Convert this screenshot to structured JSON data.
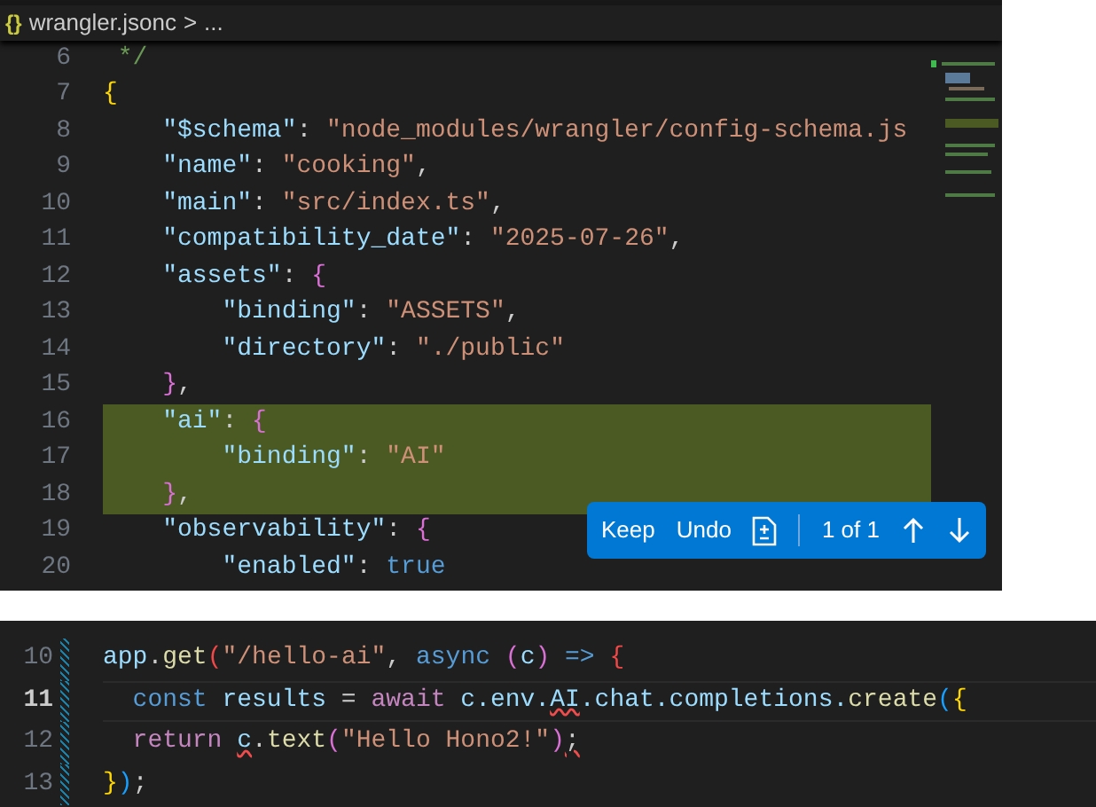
{
  "editor": {
    "breadcrumb": {
      "icon": "{}",
      "file": "wrangler.jsonc",
      "separator": ">",
      "more": "..."
    },
    "lines": [
      {
        "number": "6",
        "highlighted": false,
        "tokens": [
          {
            "kind": "comment",
            "text": " */"
          }
        ]
      },
      {
        "number": "7",
        "highlighted": false,
        "tokens": [
          {
            "kind": "brace1",
            "text": "{"
          }
        ]
      },
      {
        "number": "8",
        "highlighted": false,
        "tokens": [
          {
            "kind": "key",
            "text": "    \"$schema\""
          },
          {
            "kind": "punct",
            "text": ": "
          },
          {
            "kind": "string",
            "text": "\"node_modules/wrangler/config-schema.js"
          }
        ]
      },
      {
        "number": "9",
        "highlighted": false,
        "tokens": [
          {
            "kind": "key",
            "text": "    \"name\""
          },
          {
            "kind": "punct",
            "text": ": "
          },
          {
            "kind": "string",
            "text": "\"cooking\""
          },
          {
            "kind": "punct",
            "text": ","
          }
        ]
      },
      {
        "number": "10",
        "highlighted": false,
        "tokens": [
          {
            "kind": "key",
            "text": "    \"main\""
          },
          {
            "kind": "punct",
            "text": ": "
          },
          {
            "kind": "string",
            "text": "\"src/index.ts\""
          },
          {
            "kind": "punct",
            "text": ","
          }
        ]
      },
      {
        "number": "11",
        "highlighted": false,
        "tokens": [
          {
            "kind": "key",
            "text": "    \"compatibility_date\""
          },
          {
            "kind": "punct",
            "text": ": "
          },
          {
            "kind": "string",
            "text": "\"2025-07-26\""
          },
          {
            "kind": "punct",
            "text": ","
          }
        ]
      },
      {
        "number": "12",
        "highlighted": false,
        "tokens": [
          {
            "kind": "key",
            "text": "    \"assets\""
          },
          {
            "kind": "punct",
            "text": ": "
          },
          {
            "kind": "brace2",
            "text": "{"
          }
        ]
      },
      {
        "number": "13",
        "highlighted": false,
        "tokens": [
          {
            "kind": "key",
            "text": "        \"binding\""
          },
          {
            "kind": "punct",
            "text": ": "
          },
          {
            "kind": "string",
            "text": "\"ASSETS\""
          },
          {
            "kind": "punct",
            "text": ","
          }
        ]
      },
      {
        "number": "14",
        "highlighted": false,
        "tokens": [
          {
            "kind": "key",
            "text": "        \"directory\""
          },
          {
            "kind": "punct",
            "text": ": "
          },
          {
            "kind": "string",
            "text": "\"./public\""
          }
        ]
      },
      {
        "number": "15",
        "highlighted": false,
        "tokens": [
          {
            "kind": "brace2",
            "text": "    }"
          },
          {
            "kind": "punct",
            "text": ","
          }
        ]
      },
      {
        "number": "16",
        "highlighted": true,
        "tokens": [
          {
            "kind": "key",
            "text": "    \"ai\""
          },
          {
            "kind": "punct",
            "text": ": "
          },
          {
            "kind": "brace2",
            "text": "{"
          }
        ]
      },
      {
        "number": "17",
        "highlighted": true,
        "tokens": [
          {
            "kind": "key",
            "text": "        \"binding\""
          },
          {
            "kind": "punct",
            "text": ": "
          },
          {
            "kind": "string",
            "text": "\"AI\""
          }
        ]
      },
      {
        "number": "18",
        "highlighted": true,
        "tokens": [
          {
            "kind": "brace2",
            "text": "    }"
          },
          {
            "kind": "punct",
            "text": ","
          }
        ]
      },
      {
        "number": "19",
        "highlighted": false,
        "tokens": [
          {
            "kind": "key",
            "text": "    \"observability\""
          },
          {
            "kind": "punct",
            "text": ": "
          },
          {
            "kind": "brace2",
            "text": "{"
          }
        ]
      },
      {
        "number": "20",
        "highlighted": false,
        "tokens": [
          {
            "kind": "key",
            "text": "        \"enabled\""
          },
          {
            "kind": "punct",
            "text": ": "
          },
          {
            "kind": "keyword",
            "text": "true"
          }
        ]
      }
    ],
    "review_toolbar": {
      "keep": "Keep",
      "undo": "Undo",
      "counter": "1 of 1"
    }
  },
  "snippet": {
    "lines": [
      {
        "number": "10",
        "current": false,
        "tokens": [
          {
            "kind": "var",
            "text": "app"
          },
          {
            "kind": "punct",
            "text": "."
          },
          {
            "kind": "fn",
            "text": "get"
          },
          {
            "kind": "brace4",
            "text": "("
          },
          {
            "kind": "string",
            "text": "\"/hello-ai\""
          },
          {
            "kind": "punct",
            "text": ", "
          },
          {
            "kind": "keyword",
            "text": "async"
          },
          {
            "kind": "brace2",
            "text": " ("
          },
          {
            "kind": "var",
            "text": "c"
          },
          {
            "kind": "brace2",
            "text": ")"
          },
          {
            "kind": "keyword",
            "text": " =>"
          },
          {
            "kind": "brace4",
            "text": " {"
          }
        ]
      },
      {
        "number": "11",
        "current": true,
        "tokens": [
          {
            "kind": "keyword",
            "text": "  const"
          },
          {
            "kind": "var",
            "text": " results"
          },
          {
            "kind": "punct",
            "text": " = "
          },
          {
            "kind": "control",
            "text": "await"
          },
          {
            "kind": "var",
            "text": " c.env."
          },
          {
            "kind": "var",
            "text": "AI",
            "error": true
          },
          {
            "kind": "var",
            "text": ".chat.completions."
          },
          {
            "kind": "fn",
            "text": "create"
          },
          {
            "kind": "brace3",
            "text": "("
          },
          {
            "kind": "brace1",
            "text": "{"
          }
        ]
      },
      {
        "number": "12",
        "current": false,
        "tokens": [
          {
            "kind": "control",
            "text": "  return "
          },
          {
            "kind": "var",
            "text": "c",
            "error": true
          },
          {
            "kind": "punct",
            "text": "."
          },
          {
            "kind": "fn",
            "text": "text"
          },
          {
            "kind": "brace2",
            "text": "("
          },
          {
            "kind": "string",
            "text": "\"Hello Hono2!\""
          },
          {
            "kind": "brace2",
            "text": ")"
          },
          {
            "kind": "punct",
            "text": ";",
            "error": true
          }
        ]
      },
      {
        "number": "13",
        "current": false,
        "tokens": [
          {
            "kind": "brace1",
            "text": "}"
          },
          {
            "kind": "brace3",
            "text": ")"
          },
          {
            "kind": "punct",
            "text": ";"
          }
        ]
      }
    ]
  }
}
